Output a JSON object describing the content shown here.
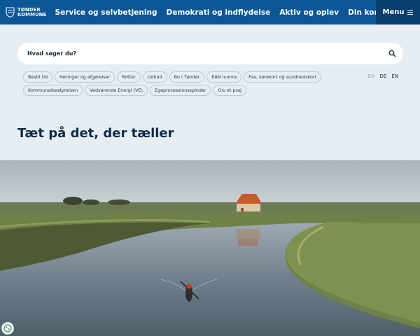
{
  "header": {
    "logo_line1": "TØNDER",
    "logo_line2": "KOMMUNE",
    "nav": [
      "Service og selvbetjening",
      "Demokrati og indflydelse",
      "Aktiv og oplev",
      "Din kommune"
    ],
    "menu_label": "Menu",
    "bg_color": "#0b5694",
    "menu_bg_color": "#073e6e"
  },
  "search": {
    "placeholder": "Hvad søger du?"
  },
  "chips": [
    "Bestil tid",
    "Høringer og afgørelser",
    "Rotter",
    "Udbud",
    "Bo i Tønder",
    "EAN numre",
    "Pas, kørekort og sundhedskort",
    "Kommunalbestyrelsen",
    "Vedvarende Energi (VE)",
    "Egeprocessionsspinder",
    "Giv et praj"
  ],
  "languages": {
    "da": "DA",
    "de": "DE",
    "en": "EN"
  },
  "headline": "Tæt på det, der tæller",
  "icons": [
    "search-icon",
    "menu-icon",
    "crest-icon",
    "cookie-icon"
  ]
}
